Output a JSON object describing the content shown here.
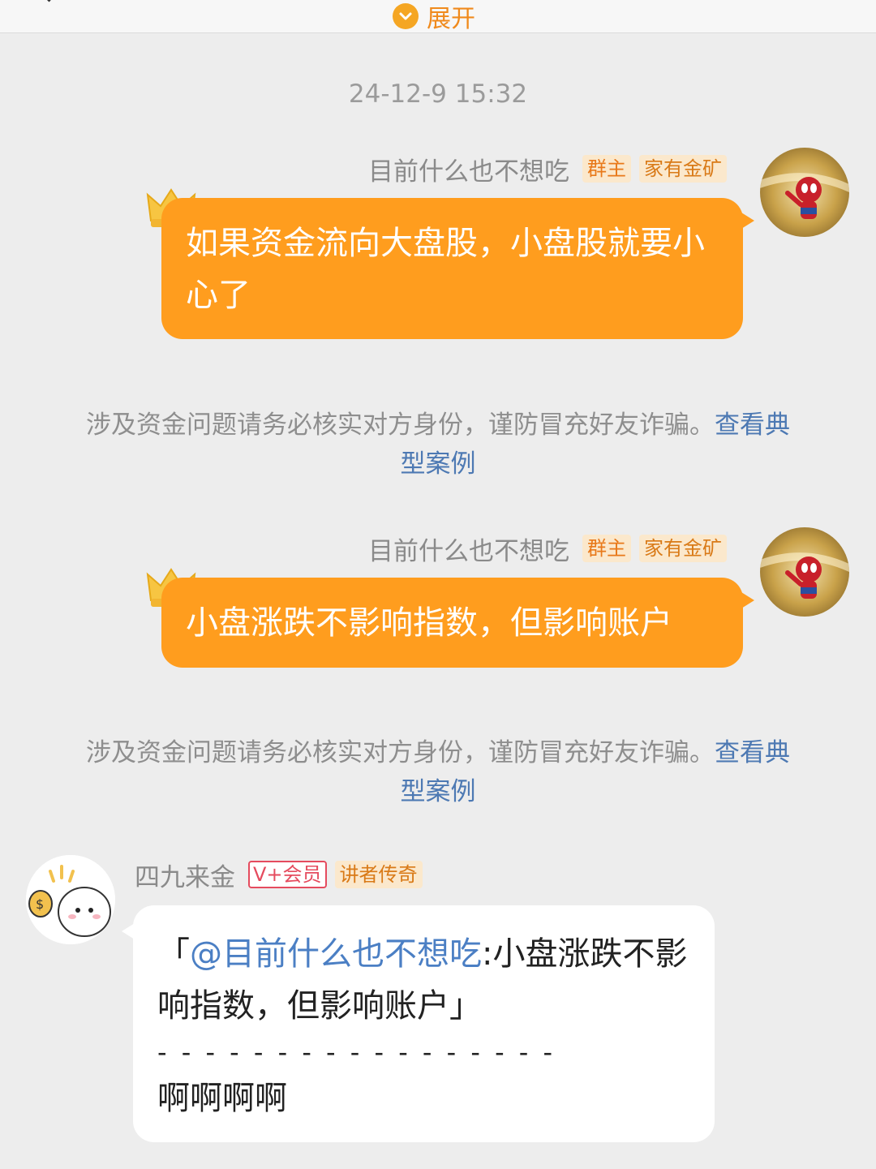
{
  "header": {
    "expand_label": "展开"
  },
  "timestamp": "24-12-9 15:32",
  "messages": [
    {
      "sender": "目前什么也不想吃",
      "tags": [
        "群主",
        "家有金矿"
      ],
      "text": "如果资金流向大盘股，小盘股就要小心了"
    },
    {
      "sender": "目前什么也不想吃",
      "tags": [
        "群主",
        "家有金矿"
      ],
      "text": "小盘涨跌不影响指数，但影响账户"
    },
    {
      "sender": "四九来金",
      "tags": [
        "V+会员",
        "讲者传奇"
      ],
      "quote_open": "「",
      "quote_mention": "@目前什么也不想吃",
      "quote_text": ":小盘涨跌不影响指数，但影响账户",
      "quote_close": "」",
      "divider": "- - - - - - - - - - - - - - - - -",
      "reply": "啊啊啊啊"
    }
  ],
  "notice": {
    "text": "涉及资金问题请务必核实对方身份，谨防冒充好友诈骗。",
    "link": "查看典型案例"
  }
}
